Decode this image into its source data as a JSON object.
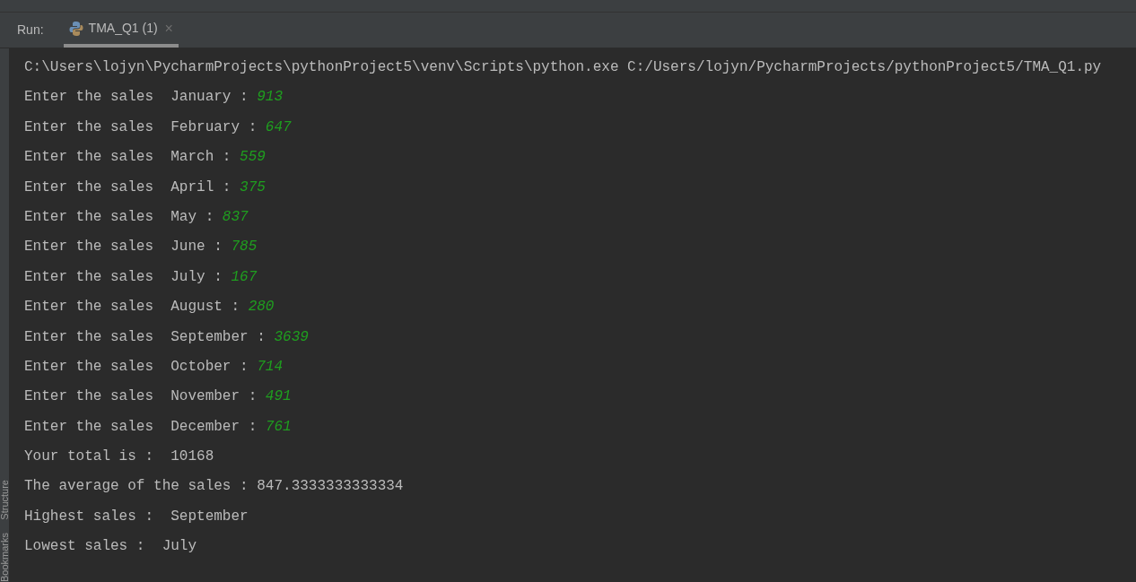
{
  "run_bar": {
    "label": "Run:",
    "tabs": [
      {
        "label": "TMA_Q1 (1)",
        "selected": true,
        "close": "×"
      }
    ]
  },
  "side_tabs": [
    "Structure",
    "Bookmarks"
  ],
  "console": [
    {
      "kind": "output",
      "text": "C:\\Users\\lojyn\\PycharmProjects\\pythonProject5\\venv\\Scripts\\python.exe C:/Users/lojyn/PycharmProjects/pythonProject5/TMA_Q1.py"
    },
    {
      "kind": "input",
      "prompt": "Enter the sales  January : ",
      "value": "913"
    },
    {
      "kind": "input",
      "prompt": "Enter the sales  February : ",
      "value": "647"
    },
    {
      "kind": "input",
      "prompt": "Enter the sales  March : ",
      "value": "559"
    },
    {
      "kind": "input",
      "prompt": "Enter the sales  April : ",
      "value": "375"
    },
    {
      "kind": "input",
      "prompt": "Enter the sales  May : ",
      "value": "837"
    },
    {
      "kind": "input",
      "prompt": "Enter the sales  June : ",
      "value": "785"
    },
    {
      "kind": "input",
      "prompt": "Enter the sales  July : ",
      "value": "167"
    },
    {
      "kind": "input",
      "prompt": "Enter the sales  August : ",
      "value": "280"
    },
    {
      "kind": "input",
      "prompt": "Enter the sales  September : ",
      "value": "3639"
    },
    {
      "kind": "input",
      "prompt": "Enter the sales  October : ",
      "value": "714"
    },
    {
      "kind": "input",
      "prompt": "Enter the sales  November : ",
      "value": "491"
    },
    {
      "kind": "input",
      "prompt": "Enter the sales  December : ",
      "value": "761"
    },
    {
      "kind": "output",
      "text": "Your total is :  10168"
    },
    {
      "kind": "output",
      "text": "The average of the sales : 847.3333333333334"
    },
    {
      "kind": "output",
      "text": "Highest sales :  September"
    },
    {
      "kind": "output",
      "text": "Lowest sales :  July"
    }
  ]
}
